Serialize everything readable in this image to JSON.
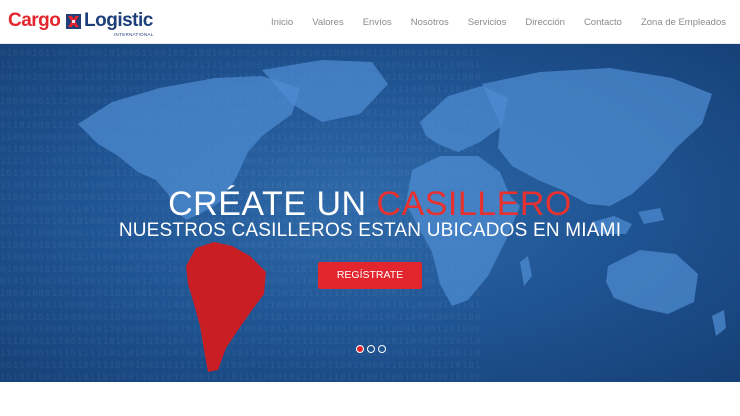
{
  "brand": {
    "word1": "Cargo",
    "word2": "Logistic",
    "tagline": "INTERNATIONAL",
    "icon": "cargo-cross-logo-icon",
    "colors": {
      "red": "#e3262d",
      "blue": "#1d3f7a"
    }
  },
  "nav": {
    "items": [
      "Inicio",
      "Valores",
      "Envíos",
      "Nosotros",
      "Servicios",
      "Dirección",
      "Contacto",
      "Zona de Empleados"
    ]
  },
  "hero": {
    "title_main": "CRÉATE UN",
    "title_accent": "CASILLERO",
    "subtitle": "NUESTROS CASILLEROS ESTAN UBICADOS EN MIAMI",
    "button": "REGÍSTRATE",
    "background_image": "world-map-icon",
    "highlight_region": "south-america",
    "colors": {
      "accent": "#e8312f",
      "background": "#1f5493",
      "highlight": "#c81e24"
    },
    "slides": {
      "count": 3,
      "active": 1
    }
  }
}
